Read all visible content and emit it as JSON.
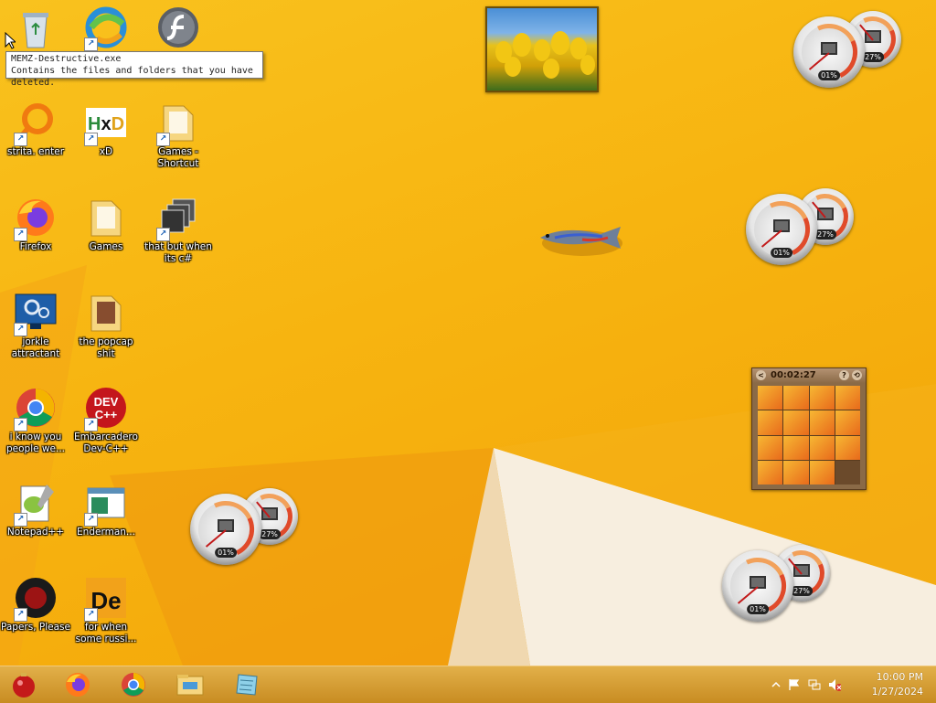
{
  "desktop": {
    "icons": [
      {
        "label": "",
        "icon": "recycle-bin-icon"
      },
      {
        "label": "",
        "icon": "edge-legacy-icon"
      },
      {
        "label": "",
        "icon": "flash-icon"
      },
      {
        "label": "strita. enter",
        "icon": "magnifier-ring-icon"
      },
      {
        "label": "xD",
        "icon": "hxd-icon"
      },
      {
        "label": "Games - Shortcut",
        "icon": "folder-icon"
      },
      {
        "label": "Firefox",
        "icon": "firefox-icon"
      },
      {
        "label": "Games",
        "icon": "folder-icon"
      },
      {
        "label": "that but when its c#",
        "icon": "stacked-windows-icon"
      },
      {
        "label": "jorkle attractant",
        "icon": "monitor-gear-icon"
      },
      {
        "label": "the popcap shit",
        "icon": "folder-icon"
      },
      {
        "label": "i know you people we...",
        "icon": "chrome-icon"
      },
      {
        "label": "Embarcadero Dev-C++",
        "icon": "devcpp-icon"
      },
      {
        "label": "Notepad++",
        "icon": "notepad-plus-plus-icon"
      },
      {
        "label": "Enderman...",
        "icon": "window-app-icon"
      },
      {
        "label": "Papers, Please",
        "icon": "papers-please-icon"
      },
      {
        "label": "for when some russi...",
        "icon": "de-app-icon"
      }
    ],
    "tooltip": {
      "line1": "MEMZ-Destructive.exe",
      "line2": "Contains the files and folders that you have deleted."
    },
    "gadgets": {
      "cpu_meter": {
        "cpu": "01%",
        "memory": "27%"
      },
      "puzzle": {
        "timer": "00:02:27",
        "help": "?",
        "shuffle": "⟲",
        "back": "<"
      }
    },
    "colors": {
      "wallpaper": "#f7b410",
      "taskbar": "#d9a03a",
      "accent": "#e04a2a"
    }
  },
  "taskbar": {
    "pinned": [
      "ornament-start-icon",
      "firefox-icon",
      "chrome-icon",
      "file-explorer-icon",
      "notebook-app-icon"
    ],
    "clock": {
      "time": "10:00 PM",
      "date": "1/27/2024"
    },
    "tray": [
      "show-hidden-icons-arrow",
      "action-center-flag-icon",
      "network-icon",
      "volume-muted-icon"
    ]
  }
}
